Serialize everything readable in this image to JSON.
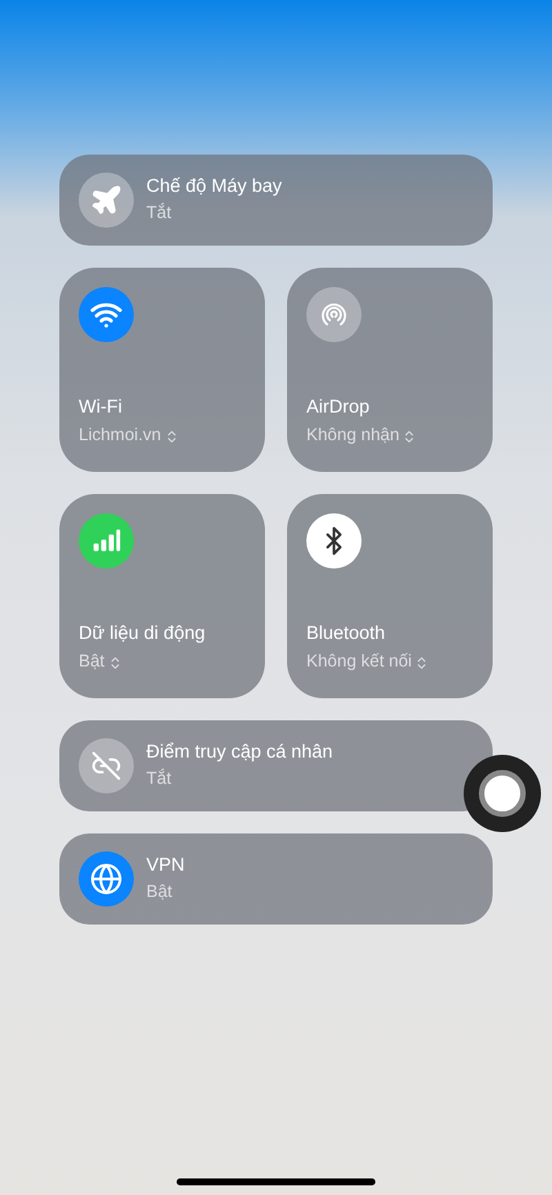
{
  "airplane_mode": {
    "kind": "airplane",
    "title": "Chế độ Máy bay",
    "status": "Tắt",
    "on": false
  },
  "tiles": [
    {
      "kind": "wifi",
      "title": "Wi-Fi",
      "status": "Lichmoi.vn",
      "on": true
    },
    {
      "kind": "airdrop",
      "title": "AirDrop",
      "status": "Không nhận",
      "on": false
    },
    {
      "kind": "cellular",
      "title": "Dữ liệu di động",
      "status": "Bật",
      "on": true
    },
    {
      "kind": "bluetooth",
      "title": "Bluetooth",
      "status": "Không kết nối",
      "on": true
    }
  ],
  "rows": [
    {
      "kind": "hotspot",
      "title": "Điểm truy cập cá nhân",
      "status": "Tắt",
      "on": false
    },
    {
      "kind": "vpn",
      "title": "VPN",
      "status": "Bật",
      "on": true
    }
  ]
}
